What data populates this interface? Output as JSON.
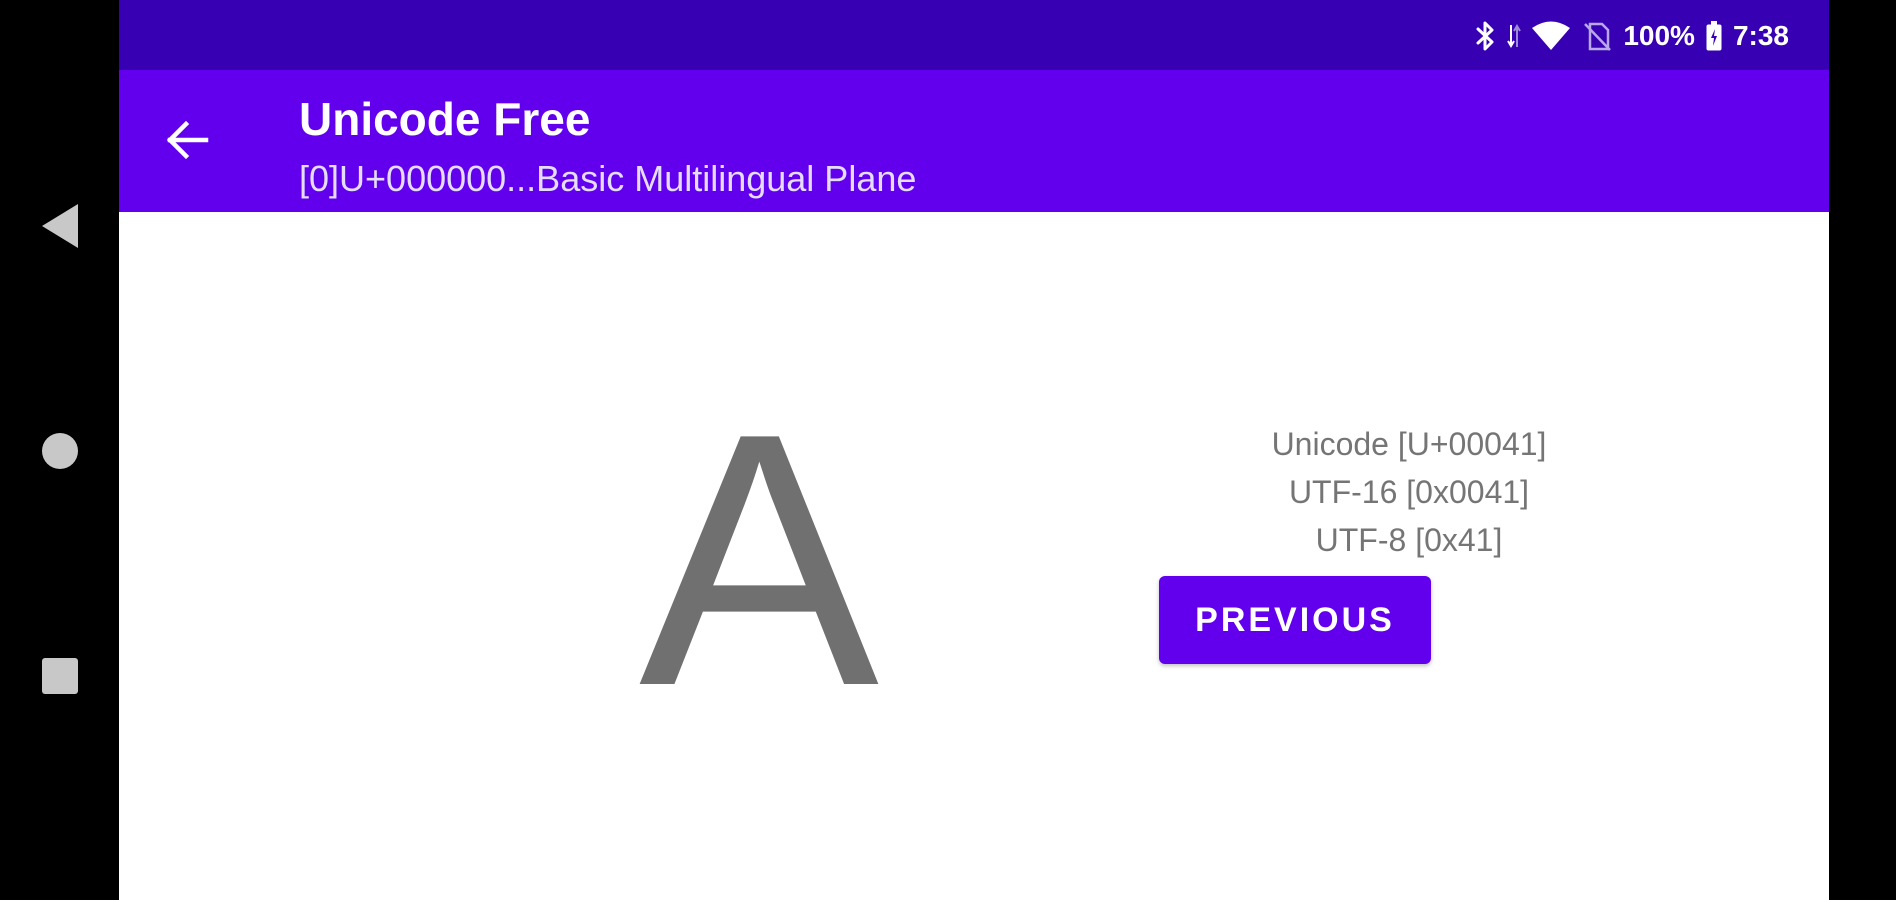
{
  "status_bar": {
    "battery": "100%",
    "time": "7:38",
    "icons": [
      "bluetooth-icon",
      "data-arrows-icon",
      "wifi-icon",
      "no-sim-icon",
      "battery-icon"
    ]
  },
  "app_bar": {
    "title": "Unicode Free",
    "subtitle": "[0]U+000000...Basic Multilingual Plane",
    "back_icon": "arrow-back-icon"
  },
  "character": {
    "glyph": "A",
    "unicode": "Unicode [U+00041]",
    "utf16": "UTF-16 [0x0041]",
    "utf8": "UTF-8 [0x41]"
  },
  "buttons": {
    "previous_label": "PREVIOUS"
  },
  "navigation": {
    "icons": [
      "back-icon",
      "home-icon",
      "recents-icon"
    ]
  },
  "colors": {
    "status_bar": "#3700b3",
    "app_bar": "#6200ee",
    "button": "#6200ee",
    "glyph": "#707070"
  }
}
